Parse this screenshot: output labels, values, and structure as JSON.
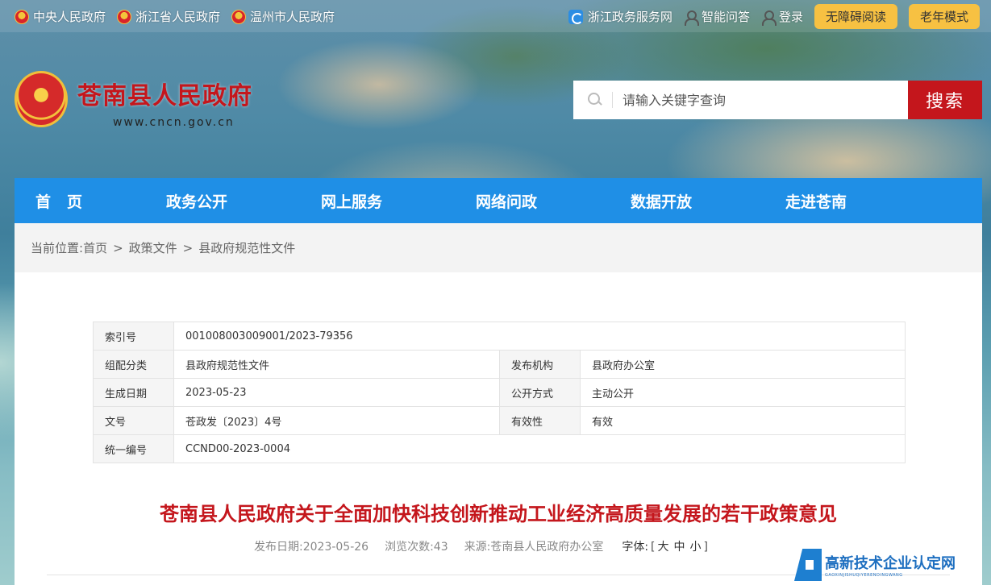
{
  "top_links": [
    "中央人民政府",
    "浙江省人民政府",
    "温州市人民政府"
  ],
  "top_right": {
    "service_link": "浙江政务服务网",
    "qa_link": "智能问答",
    "login_link": "登录",
    "accessible_btn": "无障碍阅读",
    "elder_btn": "老年模式"
  },
  "site": {
    "title": "苍南县人民政府",
    "url": "www.cncn.gov.cn"
  },
  "search": {
    "placeholder": "请输入关键字查询",
    "button": "搜索"
  },
  "nav": [
    "首页",
    "政务公开",
    "网上服务",
    "网络问政",
    "数据开放",
    "走进苍南"
  ],
  "breadcrumb": {
    "prefix": "当前位置:",
    "items": [
      "首页",
      "政策文件",
      "县政府规范性文件"
    ],
    "separator": ">"
  },
  "meta": {
    "index_no_label": "索引号",
    "index_no": "001008003009001/2023-79356",
    "category_label": "组配分类",
    "category": "县政府规范性文件",
    "issuer_label": "发布机构",
    "issuer": "县政府办公室",
    "created_label": "生成日期",
    "created": "2023-05-23",
    "disclosure_label": "公开方式",
    "disclosure": "主动公开",
    "doc_no_label": "文号",
    "doc_no": "苍政发〔2023〕4号",
    "validity_label": "有效性",
    "validity": "有效",
    "unified_no_label": "统一编号",
    "unified_no": "CCND00-2023-0004"
  },
  "article": {
    "title": "苍南县人民政府关于全面加快科技创新推动工业经济高质量发展的若干政策意见",
    "publish_date": "发布日期:2023-05-26",
    "views": "浏览次数:43",
    "source": "来源:苍南县人民政府办公室",
    "font_label": "字体:",
    "font_large": "大",
    "font_medium": "中",
    "font_small": "小"
  },
  "watermark": {
    "main": "高新技术企业认定网",
    "sub": "GAOXINJISHUQIYERENDINGWANG"
  },
  "colors": {
    "brand_red": "#c4161c",
    "nav_blue": "#1f8fe6",
    "button_yellow": "#f7c142"
  }
}
